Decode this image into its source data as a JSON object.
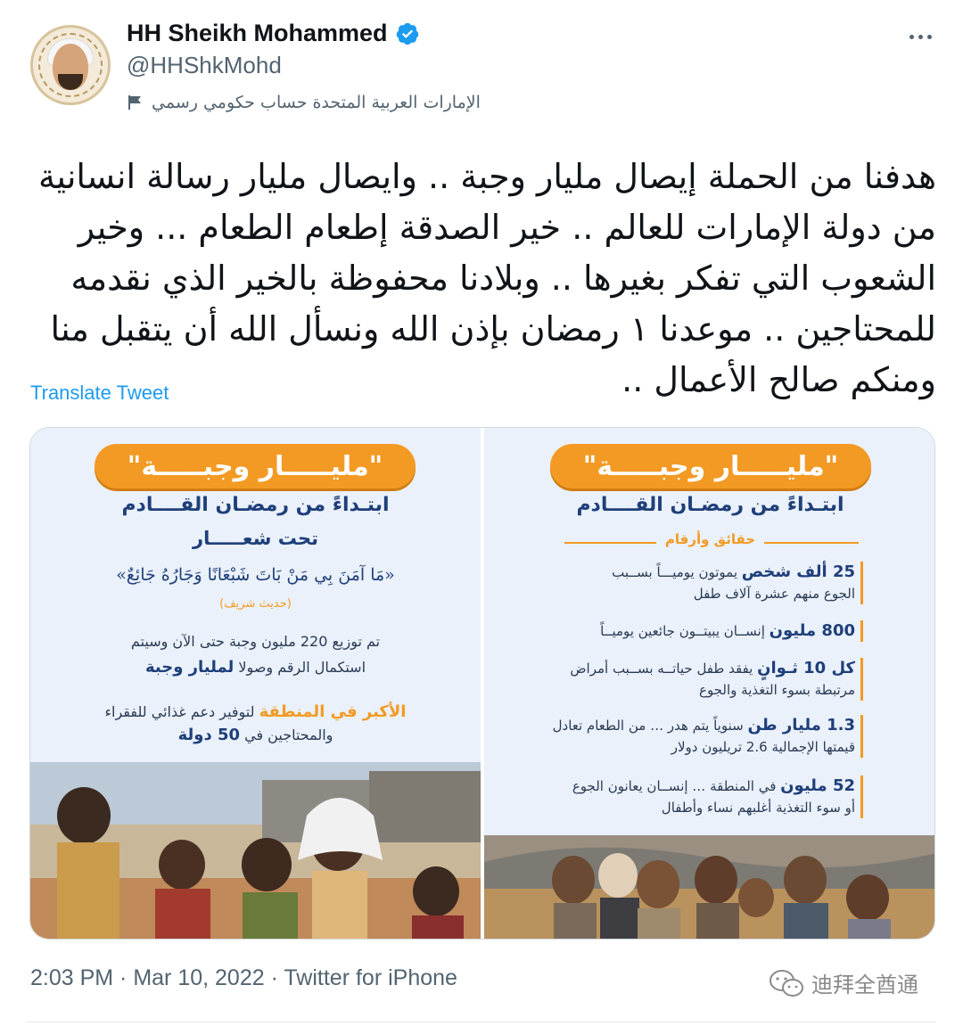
{
  "tweet": {
    "author": {
      "display_name": "HH Sheikh Mohammed",
      "handle": "@HHShkMohd",
      "verified": true,
      "label": "الإمارات العربية المتحدة حساب حكومي رسمي",
      "label_icon": "flag-icon"
    },
    "text": "هدفنا من الحملة إيصال مليار وجبة .. وايصال مليار رسالة انسانية من دولة الإمارات للعالم .. خير الصدقة إطعام الطعام ... وخير الشعوب التي تفكر بغيرها .. وبلادنا محفوظة بالخير الذي نقدمه للمحتاجين .. موعدنا ١ رمضان بإذن الله ونسأل الله أن يتقبل منا ومنكم صالح الأعمال ..",
    "translate_label": "Translate Tweet",
    "timestamp": "2:03 PM · Mar 10, 2022 · Twitter for iPhone"
  },
  "media": {
    "left": {
      "campaign_title": "\"مليـــــار وجبـــــة\"",
      "starting": "ابتـداءً من رمضـان القــــادم",
      "under_slogan": "تحت شعـــــار",
      "hadith": "«مَا آمَنَ بِي مَنْ بَاتَ شَبْعَانًا وَجَارُهُ جَائِعٌ»",
      "hadith_note": "(حديث شريف)",
      "line1": "تم توزيع 220 مليون وجبة حتى الآن وسيتم",
      "line2_prefix": "استكمال الرقم وصولا",
      "line2_bold": "لمليار وجبة",
      "line3_bold": "الأكبر في المنطقة",
      "line3_rest": "لتوفير دعم غذائي للفقراء",
      "line4_prefix": "والمحتاجين في",
      "line4_bold": "50 دولة"
    },
    "right": {
      "campaign_title": "\"مليـــــار وجبـــــة\"",
      "starting": "ابتـداءً من رمضـان القــــادم",
      "facts_heading": "حقائق وأرقام",
      "facts": [
        {
          "bold": "25 ألف شخص",
          "line1": "يموتون يوميـــاً بســبب",
          "line2": "الجوع منهم عشرة آلاف طفل"
        },
        {
          "bold": "800 مليون",
          "line1": "إنســان يبيتــون جائعين يوميــاً",
          "line2": ""
        },
        {
          "bold": "كل 10 ثـوانٍ",
          "line1": "يفقد طفل حياتــه بســبب أمراض",
          "line2": "مرتبطة بسوء التغذية والجوع"
        },
        {
          "bold": "1.3 مليار طن",
          "line1": "سنوياً يتم هدر … من الطعام تعادل",
          "line2": "قيمتها الإجمالية 2.6 تريليون دولار"
        },
        {
          "bold": "52 مليون",
          "line1": "في المنطقة … إنســان يعانون الجوع",
          "line2": "أو سوء التغذية أغلبهم نساء وأطفال"
        }
      ]
    }
  },
  "watermark": {
    "name": "迪拜全酋通",
    "icon": "wechat-icon"
  },
  "colors": {
    "accent": "#1d9bf0",
    "campaign_orange": "#f39a24",
    "campaign_navy": "#1f3f7a",
    "muted_text": "#536471"
  }
}
